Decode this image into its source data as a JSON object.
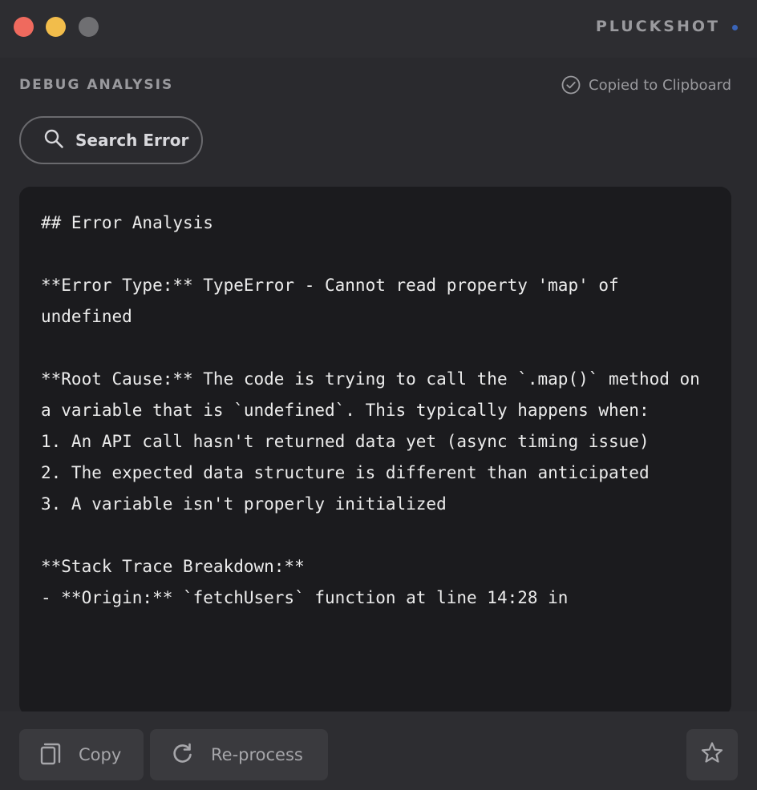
{
  "app": {
    "name": "PLUCKSHOT"
  },
  "header": {
    "section_title": "DEBUG ANALYSIS",
    "status_text": "Copied to Clipboard"
  },
  "search_button": {
    "label": "Search Error"
  },
  "analysis": {
    "content": "## Error Analysis\n\n**Error Type:** TypeError - Cannot read property 'map' of undefined\n\n**Root Cause:** The code is trying to call the `.map()` method on a variable that is `undefined`. This typically happens when:\n1. An API call hasn't returned data yet (async timing issue)\n2. The expected data structure is different than anticipated\n3. A variable isn't properly initialized\n\n**Stack Trace Breakdown:**\n- **Origin:** `fetchUsers` function at line 14:28 in"
  },
  "toolbar": {
    "copy_label": "Copy",
    "reprocess_label": "Re-process"
  },
  "colors": {
    "window_bg": "#2a2a2e",
    "panel_bg": "#1b1b1e",
    "close": "#ef6a5e",
    "minimize": "#f2bd4b",
    "zoom_disabled": "#6f6f72",
    "accent_dot": "#3a64b8"
  }
}
